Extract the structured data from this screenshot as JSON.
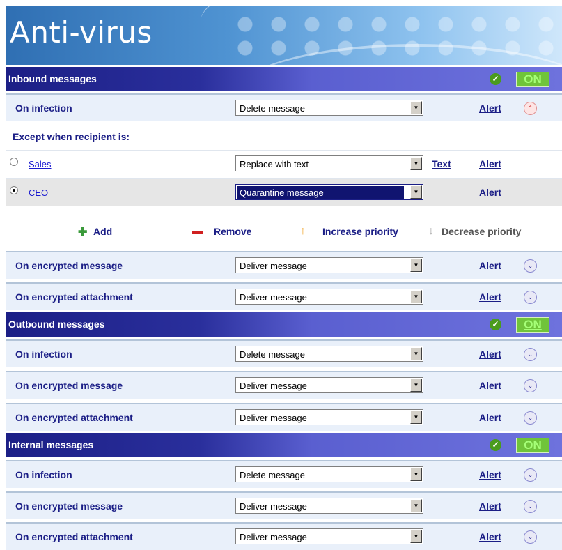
{
  "header": {
    "title": "Anti-virus"
  },
  "status_label": "ON",
  "colors": {
    "section_bg": "#1c1f86",
    "on_green": "#70c43a",
    "link": "#1b1e86",
    "selected_bg": "#101470"
  },
  "inbound": {
    "title": "Inbound messages",
    "on_infection": {
      "label": "On infection",
      "action": "Delete message",
      "alert": "Alert"
    },
    "exceptions": {
      "label": "Except when recipient is:",
      "items": [
        {
          "name": "Sales",
          "action": "Replace with text",
          "text_link": "Text",
          "alert": "Alert"
        },
        {
          "name": "CEO",
          "action": "Quarantine message",
          "alert": "Alert"
        }
      ]
    },
    "toolbar": {
      "add": "Add",
      "remove": "Remove",
      "increase": "Increase priority",
      "decrease": "Decrease priority"
    },
    "encrypted_message": {
      "label": "On encrypted message",
      "action": "Deliver message",
      "alert": "Alert"
    },
    "encrypted_attachment": {
      "label": "On encrypted attachment",
      "action": "Deliver message",
      "alert": "Alert"
    }
  },
  "outbound": {
    "title": "Outbound messages",
    "on_infection": {
      "label": "On infection",
      "action": "Delete message",
      "alert": "Alert"
    },
    "encrypted_message": {
      "label": "On encrypted message",
      "action": "Deliver message",
      "alert": "Alert"
    },
    "encrypted_attachment": {
      "label": "On encrypted attachment",
      "action": "Deliver message",
      "alert": "Alert"
    }
  },
  "internal": {
    "title": "Internal messages",
    "on_infection": {
      "label": "On infection",
      "action": "Delete message",
      "alert": "Alert"
    },
    "encrypted_message": {
      "label": "On encrypted message",
      "action": "Deliver message",
      "alert": "Alert"
    },
    "encrypted_attachment": {
      "label": "On encrypted attachment",
      "action": "Deliver message",
      "alert": "Alert"
    }
  }
}
